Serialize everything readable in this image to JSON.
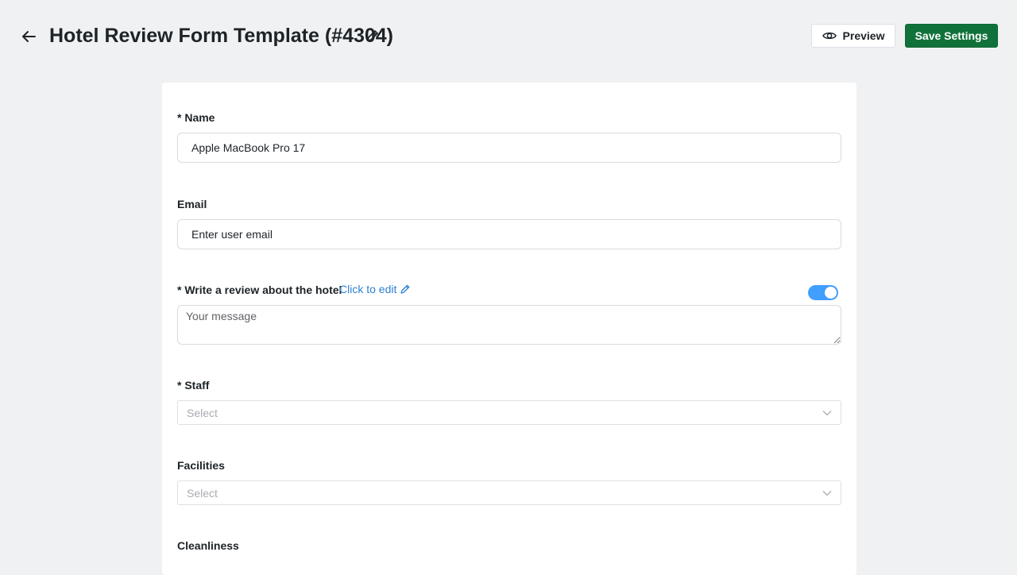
{
  "header": {
    "title": "Hotel Review Form Template (#4304)",
    "preview_label": "Preview",
    "save_label": "Save Settings",
    "save_color": "#10723a"
  },
  "form": {
    "name": {
      "label": "* Name",
      "value": "Apple MacBook Pro 17"
    },
    "email": {
      "label": "Email",
      "placeholder": "Enter user email"
    },
    "review": {
      "label": "* Write a review about the hotel",
      "edit_link": "Click to edit",
      "placeholder": "Your message",
      "toggle_on": true,
      "toggle_color": "#409eff"
    },
    "staff": {
      "label": "* Staff",
      "placeholder": "Select"
    },
    "facilities": {
      "label": "Facilities",
      "placeholder": "Select"
    },
    "cleanliness": {
      "label": "Cleanliness"
    }
  },
  "icons": {
    "back": "arrow-left-icon",
    "title_edit": "pencil-icon",
    "preview": "eye-icon",
    "edit_link": "pencil-icon",
    "select": "chevron-down-icon"
  }
}
